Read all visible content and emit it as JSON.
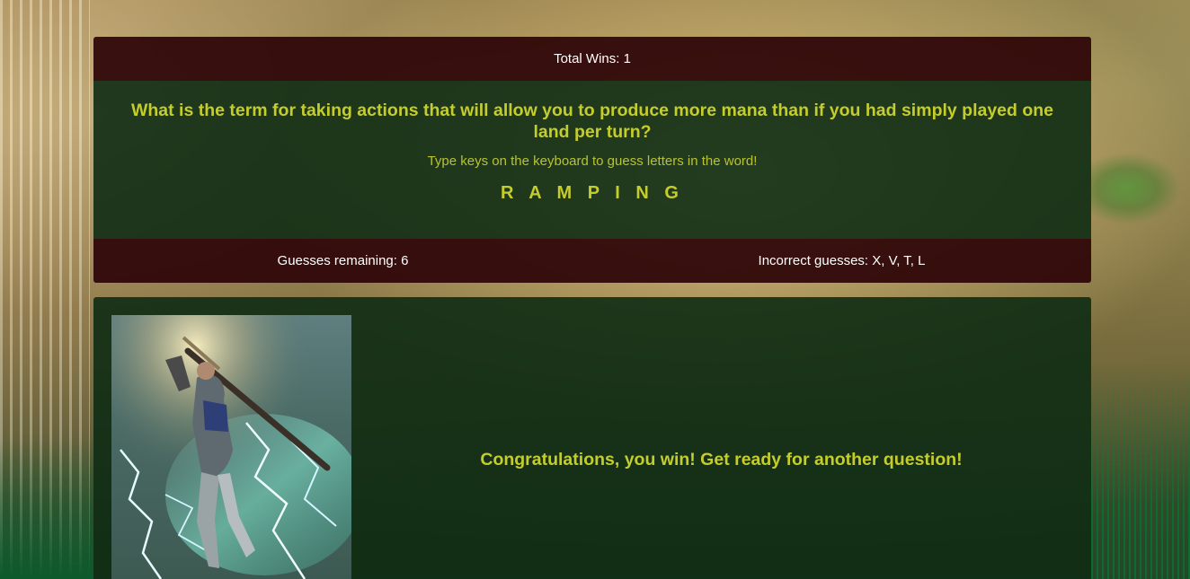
{
  "scoreboard": {
    "total_wins_label": "Total Wins: 1"
  },
  "game": {
    "question": "What is the term for taking actions that will allow you to produce more mana than if you had simply played one land per turn?",
    "instruction": "Type keys on the keyboard to guess letters in the word!",
    "revealed_word": "R A M P I N G",
    "guesses_remaining_label": "Guesses remaining: 6",
    "incorrect_guesses_label": "Incorrect guesses: X, V, T, L"
  },
  "result": {
    "message": "Congratulations, you win! Get ready for another question!"
  },
  "colors": {
    "accent_text": "#c4cd2c",
    "header_bg": "#2d0408",
    "panel_bg": "#0e2c14"
  }
}
